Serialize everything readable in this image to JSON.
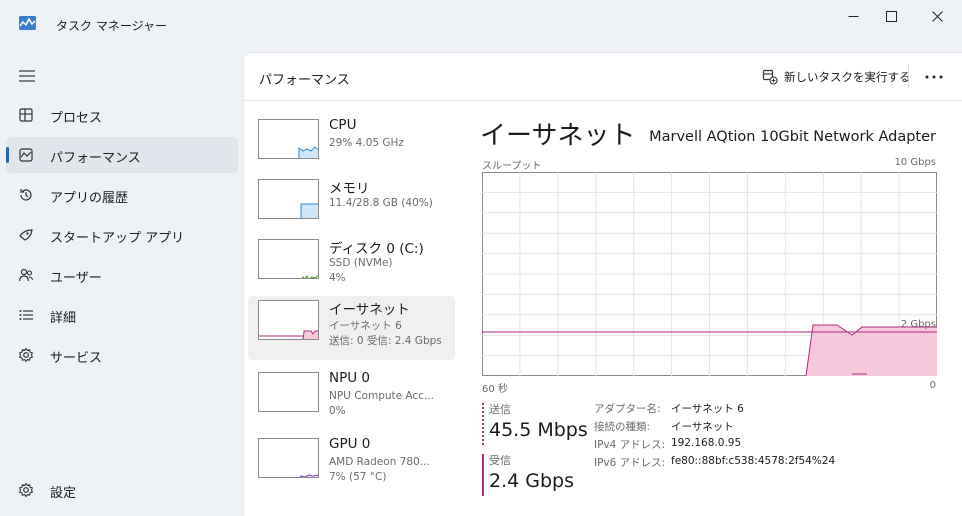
{
  "window": {
    "title": "タスク マネージャー"
  },
  "sidebar": {
    "items": [
      {
        "label": "プロセス",
        "icon": "processes-icon"
      },
      {
        "label": "パフォーマンス",
        "icon": "performance-icon",
        "active": true
      },
      {
        "label": "アプリの履歴",
        "icon": "history-icon"
      },
      {
        "label": "スタートアップ アプリ",
        "icon": "startup-icon"
      },
      {
        "label": "ユーザー",
        "icon": "users-icon"
      },
      {
        "label": "詳細",
        "icon": "details-icon"
      },
      {
        "label": "サービス",
        "icon": "services-icon"
      }
    ],
    "settings_label": "設定"
  },
  "toolbar": {
    "title": "パフォーマンス",
    "new_task_label": "新しいタスクを実行する"
  },
  "devices": [
    {
      "name": "CPU",
      "sub1": "29%  4.05 GHz",
      "sub2": "",
      "graph_color": "#2a8fd6",
      "fill": "#cfe6f7"
    },
    {
      "name": "メモリ",
      "sub1": "11.4/28.8 GB (40%)",
      "sub2": "",
      "graph_color": "#2a8fd6",
      "fill": "#cfe6f7"
    },
    {
      "name": "ディスク 0 (C:)",
      "sub1": "SSD (NVMe)",
      "sub2": "4%",
      "graph_color": "#4e9a06",
      "fill": "#dff0cc"
    },
    {
      "name": "イーサネット",
      "sub1": "イーサネット 6",
      "sub2": "送信: 0 受信: 2.4 Gbps",
      "graph_color": "#b22a7c",
      "fill": "#f6c8dc",
      "active": true
    },
    {
      "name": "NPU 0",
      "sub1": "NPU Compute Acc...",
      "sub2": "0%",
      "graph_color": "#2a8fd6",
      "fill": "#cfe6f7"
    },
    {
      "name": "GPU 0",
      "sub1": "AMD Radeon 780...",
      "sub2": "7% (57 °C)",
      "graph_color": "#8a3cc8",
      "fill": "#e6d4f5"
    }
  ],
  "detail": {
    "title": "イーサネット",
    "adapter": "Marvell AQtion 10Gbit Network Adapter",
    "graph_top_left": "スループット",
    "graph_top_right": "10 Gbps",
    "graph_mid_right": "2 Gbps",
    "graph_bottom_left": "60 秒",
    "graph_bottom_right": "0",
    "send_label": "送信",
    "send_value": "45.5 Mbps",
    "recv_label": "受信",
    "recv_value": "2.4 Gbps",
    "properties": [
      {
        "key": "アダプター名:",
        "value": "イーサネット 6"
      },
      {
        "key": "接続の種類:",
        "value": "イーサネット"
      },
      {
        "key": "IPv4 アドレス:",
        "value": "192.168.0.95"
      },
      {
        "key": "IPv6 アドレス:",
        "value": "fe80::88bf:c538:4578:2f54%24"
      }
    ]
  },
  "colors": {
    "accent": "#2a62b6",
    "ethernet": "#b22a7c",
    "ethernet_fill": "#f6c8dc"
  }
}
